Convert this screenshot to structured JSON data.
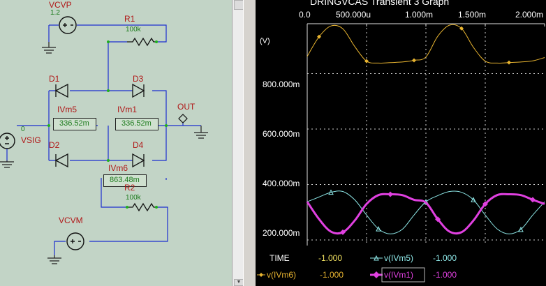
{
  "schematic": {
    "vcvp": {
      "name": "VCVP",
      "value": "1.2"
    },
    "vcvm": {
      "name": "VCVM"
    },
    "r1": {
      "name": "R1",
      "value": "100k"
    },
    "r2": {
      "name": "R2",
      "value": "100k"
    },
    "d1": "D1",
    "d2": "D2",
    "d3": "D3",
    "d4": "D4",
    "out": "OUT",
    "vsig": {
      "name": "VSIG",
      "value": "0"
    },
    "ivm5": {
      "name": "IVm5",
      "reading": "336.52m"
    },
    "ivm1": {
      "name": "IVm1",
      "reading": "336.52m"
    },
    "ivm6": {
      "name": "IVm6",
      "reading": "863.48m"
    }
  },
  "graph": {
    "title": "DRINGVCAS Transient 3 Graph",
    "y_unit": "(V)",
    "legend": {
      "time_label": "TIME",
      "time_value": "-1.000",
      "ivm5_label": "v(IVm5)",
      "ivm5_value": "-1.000",
      "ivm6_label": "v(IVm6)",
      "ivm6_value": "-1.000",
      "ivm1_label": "v(IVm1)",
      "ivm1_value": "-1.000"
    }
  },
  "colors": {
    "ivm6": "#e8b430",
    "ivm5": "#8ee8e8",
    "ivm1": "#e040e0",
    "schematic_bg": "#c2d4c6",
    "wire": "#1c2fd0"
  },
  "chart_data": {
    "type": "line",
    "title": "DRINGVCAS Transient 3 Graph",
    "xlabel": "",
    "ylabel": "(V)",
    "x_tick_labels": [
      "0.0",
      "500.000u",
      "1.000m",
      "1.500m",
      "2.000m"
    ],
    "y_tick_labels": [
      "800.000m",
      "600.000m",
      "400.000m",
      "200.000m"
    ],
    "xlim": [
      0,
      0.002
    ],
    "ylim": [
      180,
      980
    ],
    "grid": true,
    "x": [
      0,
      0.0001,
      0.0002,
      0.0003,
      0.0004,
      0.0005,
      0.0006,
      0.0007,
      0.0008,
      0.0009,
      0.001,
      0.0011,
      0.0012,
      0.0013,
      0.0014,
      0.0015,
      0.0016,
      0.0017,
      0.0018,
      0.0019,
      0.002
    ],
    "series": [
      {
        "name": "v(IVm6)",
        "values": [
          862,
          933,
          972,
          962,
          898,
          845,
          838,
          840,
          842,
          848,
          860,
          935,
          975,
          963,
          895,
          845,
          838,
          840,
          842,
          846,
          858
        ]
      },
      {
        "name": "v(IVm5)",
        "values": [
          338,
          355,
          372,
          375,
          345,
          290,
          240,
          222,
          238,
          290,
          338,
          360,
          375,
          372,
          345,
          290,
          240,
          222,
          238,
          290,
          338
        ]
      },
      {
        "name": "v(IVm1)",
        "values": [
          338,
          275,
          230,
          228,
          270,
          330,
          362,
          365,
          362,
          345,
          335,
          275,
          230,
          228,
          270,
          330,
          362,
          365,
          362,
          345,
          330
        ]
      }
    ]
  }
}
